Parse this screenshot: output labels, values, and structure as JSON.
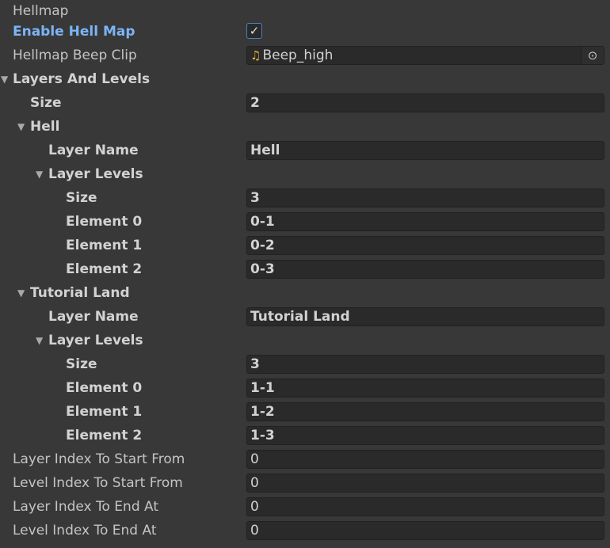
{
  "header": {
    "title": "Hellmap"
  },
  "enable_hell_map": {
    "label": "Enable Hell Map",
    "checked": true,
    "check_glyph": "✓"
  },
  "beep_clip": {
    "label": "Hellmap Beep Clip",
    "value": "Beep_high",
    "icon": "audio-clip-icon",
    "picker_glyph": "⊙"
  },
  "layers": {
    "label": "Layers And Levels",
    "size_label": "Size",
    "size_value": "2",
    "items": [
      {
        "label": "Hell",
        "layer_name_label": "Layer Name",
        "layer_name_value": "Hell",
        "levels_label": "Layer Levels",
        "size_label": "Size",
        "size_value": "3",
        "elements": [
          {
            "label": "Element 0",
            "value": "0-1"
          },
          {
            "label": "Element 1",
            "value": "0-2"
          },
          {
            "label": "Element 2",
            "value": "0-3"
          }
        ]
      },
      {
        "label": "Tutorial Land",
        "layer_name_label": "Layer Name",
        "layer_name_value": "Tutorial Land",
        "levels_label": "Layer Levels",
        "size_label": "Size",
        "size_value": "3",
        "elements": [
          {
            "label": "Element 0",
            "value": "1-1"
          },
          {
            "label": "Element 1",
            "value": "1-2"
          },
          {
            "label": "Element 2",
            "value": "1-3"
          }
        ]
      }
    ]
  },
  "layer_index_start": {
    "label": "Layer Index To Start From",
    "value": "0"
  },
  "level_index_start": {
    "label": "Level Index To Start From",
    "value": "0"
  },
  "layer_index_end": {
    "label": "Layer Index To End At",
    "value": "0"
  },
  "level_index_end": {
    "label": "Level Index To End At",
    "value": "0"
  },
  "colors": {
    "background": "#383838",
    "field": "#2a2a2a",
    "accent_blue": "#7cb4f6",
    "audio_icon": "#e8b730"
  }
}
